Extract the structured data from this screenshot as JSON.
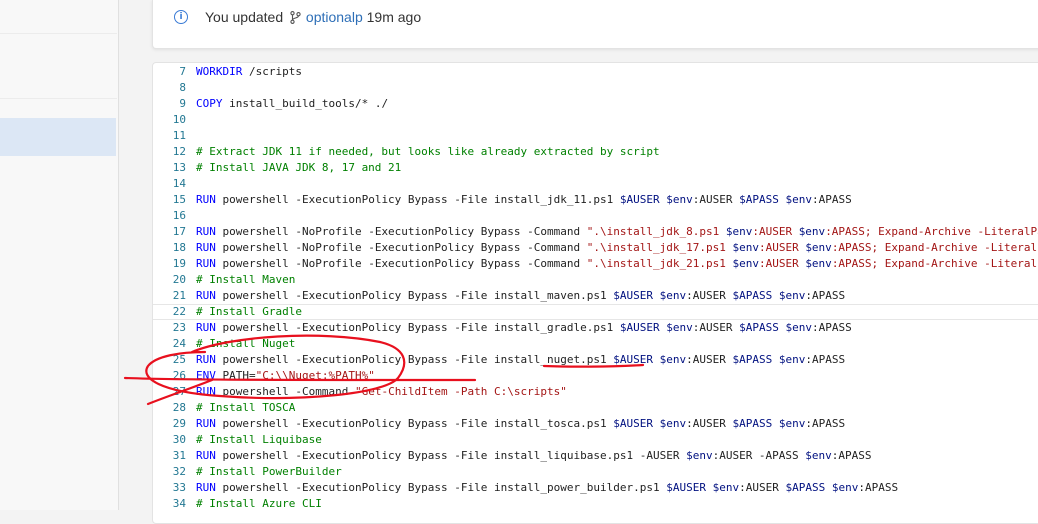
{
  "notification": {
    "prefix": "You updated",
    "branch": "optionalp",
    "time": "19m ago"
  },
  "icons": {
    "info": "info-icon",
    "branch": "branch-icon"
  },
  "colors": {
    "keyword": "#0000ff",
    "comment": "#008000",
    "string": "#a31515",
    "variable": "#001080",
    "line_number": "#237893",
    "annotation": "#e8101e"
  },
  "code": {
    "highlighted_line": "22",
    "lines": [
      {
        "n": "7",
        "segs": [
          [
            "kw",
            "WORKDIR"
          ],
          [
            "t",
            " /scripts"
          ]
        ]
      },
      {
        "n": "8",
        "segs": []
      },
      {
        "n": "9",
        "segs": [
          [
            "kw",
            "COPY"
          ],
          [
            "t",
            " install_build_tools/* ./"
          ]
        ]
      },
      {
        "n": "10",
        "segs": []
      },
      {
        "n": "11",
        "segs": []
      },
      {
        "n": "12",
        "segs": [
          [
            "cm",
            "# Extract JDK 11 if needed, but looks like already extracted by script"
          ]
        ]
      },
      {
        "n": "13",
        "segs": [
          [
            "cm",
            "# Install JAVA JDK 8, 17 and 21"
          ]
        ]
      },
      {
        "n": "14",
        "segs": []
      },
      {
        "n": "15",
        "segs": [
          [
            "kw",
            "RUN"
          ],
          [
            "t",
            " powershell -ExecutionPolicy Bypass -File install_jdk_11.ps1 "
          ],
          [
            "var",
            "$AUSER"
          ],
          [
            "t",
            " "
          ],
          [
            "var",
            "$env"
          ],
          [
            "t",
            ":AUSER "
          ],
          [
            "var",
            "$APASS"
          ],
          [
            "t",
            " "
          ],
          [
            "var",
            "$env"
          ],
          [
            "t",
            ":APASS"
          ]
        ]
      },
      {
        "n": "16",
        "segs": []
      },
      {
        "n": "17",
        "segs": [
          [
            "kw",
            "RUN"
          ],
          [
            "t",
            " powershell -NoProfile -ExecutionPolicy Bypass -Command "
          ],
          [
            "str",
            "\".\\install_jdk_8.ps1 "
          ],
          [
            "var",
            "$env"
          ],
          [
            "str",
            ":AUSER "
          ],
          [
            "var",
            "$env"
          ],
          [
            "str",
            ":APASS; Expand-Archive -LiteralPath"
          ]
        ]
      },
      {
        "n": "18",
        "segs": [
          [
            "kw",
            "RUN"
          ],
          [
            "t",
            " powershell -NoProfile -ExecutionPolicy Bypass -Command "
          ],
          [
            "str",
            "\".\\install_jdk_17.ps1 "
          ],
          [
            "var",
            "$env"
          ],
          [
            "str",
            ":AUSER "
          ],
          [
            "var",
            "$env"
          ],
          [
            "str",
            ":APASS; Expand-Archive -LiteralPath"
          ]
        ]
      },
      {
        "n": "19",
        "segs": [
          [
            "kw",
            "RUN"
          ],
          [
            "t",
            " powershell -NoProfile -ExecutionPolicy Bypass -Command "
          ],
          [
            "str",
            "\".\\install_jdk_21.ps1 "
          ],
          [
            "var",
            "$env"
          ],
          [
            "str",
            ":AUSER "
          ],
          [
            "var",
            "$env"
          ],
          [
            "str",
            ":APASS; Expand-Archive -LiteralPath"
          ]
        ]
      },
      {
        "n": "20",
        "segs": [
          [
            "cm",
            "# Install Maven"
          ]
        ]
      },
      {
        "n": "21",
        "segs": [
          [
            "kw",
            "RUN"
          ],
          [
            "t",
            " powershell -ExecutionPolicy Bypass -File install_maven.ps1 "
          ],
          [
            "var",
            "$AUSER"
          ],
          [
            "t",
            " "
          ],
          [
            "var",
            "$env"
          ],
          [
            "t",
            ":AUSER "
          ],
          [
            "var",
            "$APASS"
          ],
          [
            "t",
            " "
          ],
          [
            "var",
            "$env"
          ],
          [
            "t",
            ":APASS"
          ]
        ]
      },
      {
        "n": "22",
        "segs": [
          [
            "cm",
            "# Install Gradle"
          ]
        ]
      },
      {
        "n": "23",
        "segs": [
          [
            "kw",
            "RUN"
          ],
          [
            "t",
            " powershell -ExecutionPolicy Bypass -File install_gradle.ps1 "
          ],
          [
            "var",
            "$AUSER"
          ],
          [
            "t",
            " "
          ],
          [
            "var",
            "$env"
          ],
          [
            "t",
            ":AUSER "
          ],
          [
            "var",
            "$APASS"
          ],
          [
            "t",
            " "
          ],
          [
            "var",
            "$env"
          ],
          [
            "t",
            ":APASS"
          ]
        ]
      },
      {
        "n": "24",
        "segs": [
          [
            "cm",
            "# Install Nuget"
          ]
        ]
      },
      {
        "n": "25",
        "segs": [
          [
            "kw",
            "RUN"
          ],
          [
            "t",
            " powershell -ExecutionPolicy Bypass -File install_nuget.ps1 "
          ],
          [
            "var",
            "$AUSER"
          ],
          [
            "t",
            " "
          ],
          [
            "var",
            "$env"
          ],
          [
            "t",
            ":AUSER "
          ],
          [
            "var",
            "$APASS"
          ],
          [
            "t",
            " "
          ],
          [
            "var",
            "$env"
          ],
          [
            "t",
            ":APASS"
          ]
        ]
      },
      {
        "n": "26",
        "segs": [
          [
            "kw",
            "ENV"
          ],
          [
            "t",
            " PATH="
          ],
          [
            "str",
            "\"C:\\\\Nuget;%PATH%\""
          ]
        ]
      },
      {
        "n": "27",
        "segs": [
          [
            "kw",
            "RUN"
          ],
          [
            "t",
            " powershell -Command "
          ],
          [
            "str",
            "\"Get-ChildItem -Path C:\\scripts\""
          ]
        ]
      },
      {
        "n": "28",
        "segs": [
          [
            "cm",
            "# Install TOSCA"
          ]
        ]
      },
      {
        "n": "29",
        "segs": [
          [
            "kw",
            "RUN"
          ],
          [
            "t",
            " powershell -ExecutionPolicy Bypass -File install_tosca.ps1 "
          ],
          [
            "var",
            "$AUSER"
          ],
          [
            "t",
            " "
          ],
          [
            "var",
            "$env"
          ],
          [
            "t",
            ":AUSER "
          ],
          [
            "var",
            "$APASS"
          ],
          [
            "t",
            " "
          ],
          [
            "var",
            "$env"
          ],
          [
            "t",
            ":APASS"
          ]
        ]
      },
      {
        "n": "30",
        "segs": [
          [
            "cm",
            "# Install Liquibase"
          ]
        ]
      },
      {
        "n": "31",
        "segs": [
          [
            "kw",
            "RUN"
          ],
          [
            "t",
            " powershell -ExecutionPolicy Bypass -File install_liquibase.ps1 -AUSER "
          ],
          [
            "var",
            "$env"
          ],
          [
            "t",
            ":AUSER -APASS "
          ],
          [
            "var",
            "$env"
          ],
          [
            "t",
            ":APASS"
          ]
        ]
      },
      {
        "n": "32",
        "segs": [
          [
            "cm",
            "# Install PowerBuilder"
          ]
        ]
      },
      {
        "n": "33",
        "segs": [
          [
            "kw",
            "RUN"
          ],
          [
            "t",
            " powershell -ExecutionPolicy Bypass -File install_power_builder.ps1 "
          ],
          [
            "var",
            "$AUSER"
          ],
          [
            "t",
            " "
          ],
          [
            "var",
            "$env"
          ],
          [
            "t",
            ":AUSER "
          ],
          [
            "var",
            "$APASS"
          ],
          [
            "t",
            " "
          ],
          [
            "var",
            "$env"
          ],
          [
            "t",
            ":APASS"
          ]
        ]
      },
      {
        "n": "34",
        "segs": [
          [
            "cm",
            "# Install Azure CLI"
          ]
        ]
      }
    ]
  }
}
